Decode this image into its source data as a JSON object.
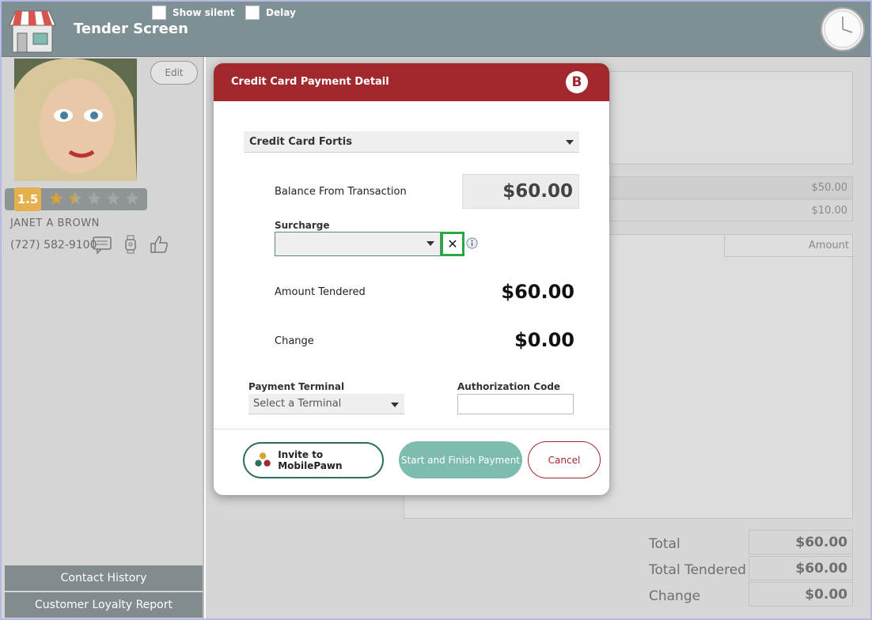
{
  "header": {
    "title": "Tender Screen",
    "show_silent_label": "Show silent",
    "delay_label": "Delay"
  },
  "customer": {
    "edit_label": "Edit",
    "rating": "1.5",
    "rating_value": 1.5,
    "rating_max": 5,
    "name": "JANET A BROWN",
    "phone": "(727) 582-9100"
  },
  "left_buttons": {
    "contact_history": "Contact History",
    "loyalty_report": "Customer Loyalty Report"
  },
  "background": {
    "mini_rows": [
      "$50.00",
      "$10.00"
    ],
    "amount_header": "Amount",
    "totals": [
      {
        "label": "Total",
        "value": "$60.00"
      },
      {
        "label": "Total Tendered",
        "value": "$60.00"
      },
      {
        "label": "Change",
        "value": "$0.00"
      }
    ]
  },
  "modal": {
    "title": "Credit Card Payment Detail",
    "logo_letter": "B",
    "payment_type": "Credit Card Fortis",
    "balance_label": "Balance From Transaction",
    "balance_value": "$60.00",
    "surcharge_label": "Surcharge",
    "clear_symbol": "✕",
    "amount_tendered_label": "Amount Tendered",
    "amount_tendered_value": "$60.00",
    "change_label": "Change",
    "change_value": "$0.00",
    "terminal_label": "Payment Terminal",
    "terminal_placeholder": "Select a Terminal",
    "auth_label": "Authorization Code",
    "auth_value": "",
    "invite_label": "Invite to MobilePawn",
    "start_label": "Start and Finish Payment",
    "cancel_label": "Cancel"
  },
  "colors": {
    "header_bg": "#7f9094",
    "modal_header": "#a1282c",
    "accent_teal": "#2f6e62",
    "highlight_green": "#29a83f",
    "rating_badge": "#e6b04c"
  }
}
